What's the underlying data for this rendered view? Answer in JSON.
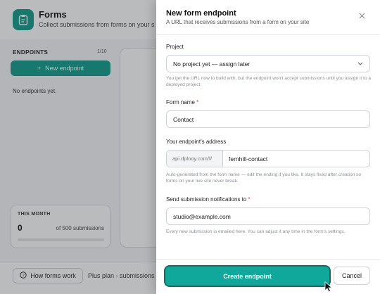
{
  "page": {
    "title": "Forms",
    "subtitle": "Collect submissions from forms on your s",
    "endpoints_label": "ENDPOINTS",
    "endpoints_count": "1/10",
    "new_endpoint_label": "New endpoint",
    "empty_text": "No endpoints yet.",
    "month_label": "THIS MONTH",
    "month_value": "0",
    "month_of": "of 500 submissions",
    "how_forms_work": "How forms work",
    "plan_text": "Plus plan - submissions k"
  },
  "drawer": {
    "title": "New form endpoint",
    "subtitle": "A URL that receives submissions from a form on your site",
    "project": {
      "label": "Project",
      "value": "No project yet — assign later",
      "help": "You get the URL now to build with, but the endpoint won't accept submissions until you assign it to a deployed project."
    },
    "form_name": {
      "label": "Form name",
      "required_mark": "*",
      "value": "Contact"
    },
    "address": {
      "label": "Your endpoint's address",
      "prefix": "api.dplooy.com/f/",
      "value": "fernhill-contact",
      "help": "Auto-generated from the form name — edit the ending if you like. It stays fixed after creation so forms on your live site never break."
    },
    "notify": {
      "label": "Send submission notifications to",
      "required_mark": "*",
      "value": "studio@example.com",
      "help": "Every new submission is emailed here. You can adjust it any time in the form's settings."
    },
    "create_label": "Create endpoint",
    "cancel_label": "Cancel"
  },
  "colors": {
    "accent": "#0fa89a",
    "required": "#d93636"
  }
}
